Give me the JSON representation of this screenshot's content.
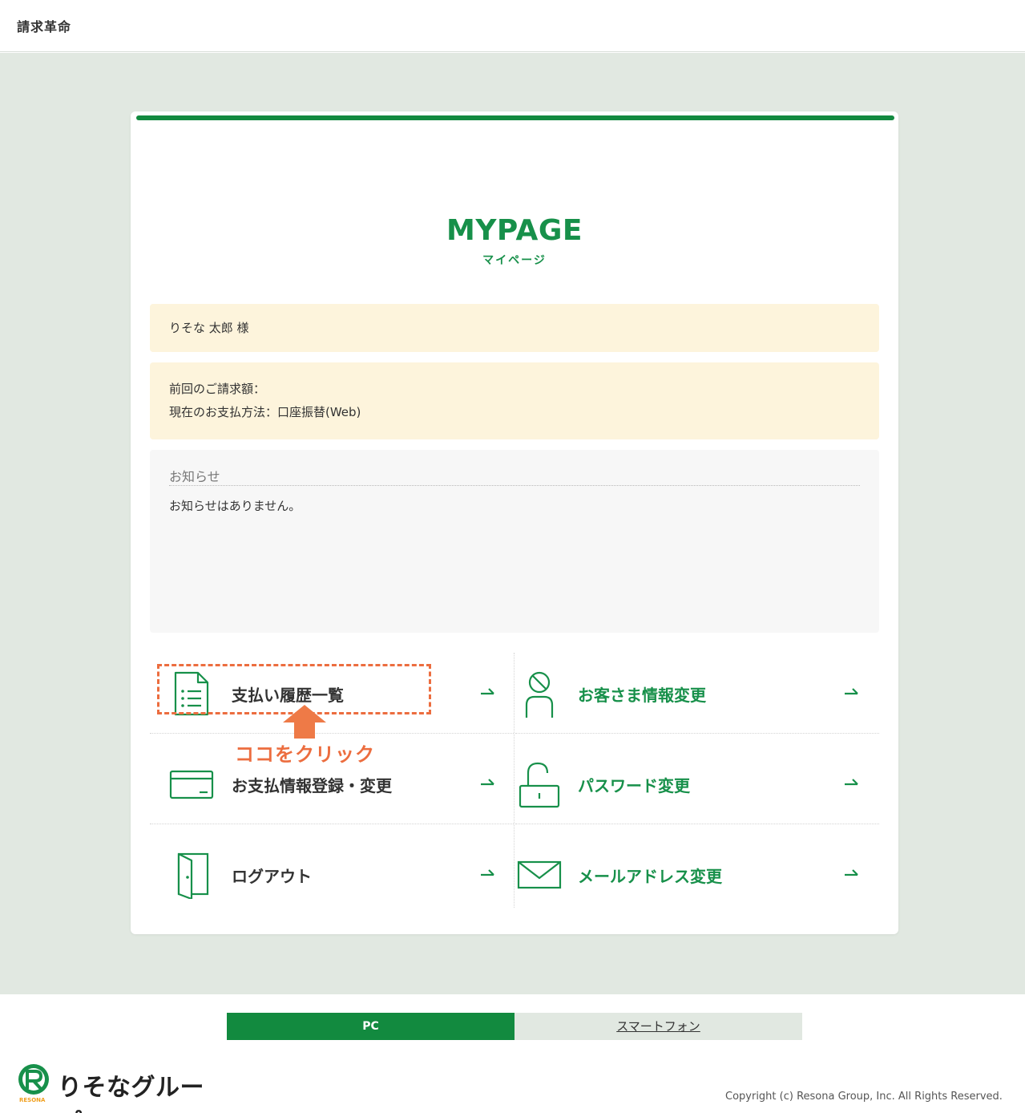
{
  "header": {
    "app_title": "請求革命"
  },
  "mypage": {
    "title": "MYPAGE",
    "subtitle": "マイページ"
  },
  "user": {
    "name": "りそな 太郎 様"
  },
  "billing": {
    "last_amount_label": "前回のご請求額：",
    "payment_method_label": "現在のお支払方法：口座振替(Web)"
  },
  "news": {
    "title": "お知らせ",
    "body": "お知らせはありません。"
  },
  "menu": {
    "payment_history": "支払い履歴一覧",
    "customer_info": "お客さま情報変更",
    "payment_info": "お支払情報登録・変更",
    "password": "パスワード変更",
    "logout": "ログアウト",
    "email": "メールアドレス変更"
  },
  "annotation": {
    "hint": "ココをクリック"
  },
  "footer": {
    "pc": "PC",
    "smartphone": "スマートフォン",
    "logo": "りそなグループ",
    "logo_sub": "RESONA",
    "copyright": "Copyright (c) Resona Group, Inc. All Rights Reserved."
  },
  "colors": {
    "brand_green": "#128a3f",
    "accent_orange": "#ec6d3f",
    "info_bg": "#fdf4dc"
  },
  "icons": {
    "payment_history": "document-list-icon",
    "customer_info": "person-icon",
    "payment_info": "credit-card-icon",
    "password": "unlocked-padlock-icon",
    "logout": "door-icon",
    "email": "envelope-icon"
  }
}
